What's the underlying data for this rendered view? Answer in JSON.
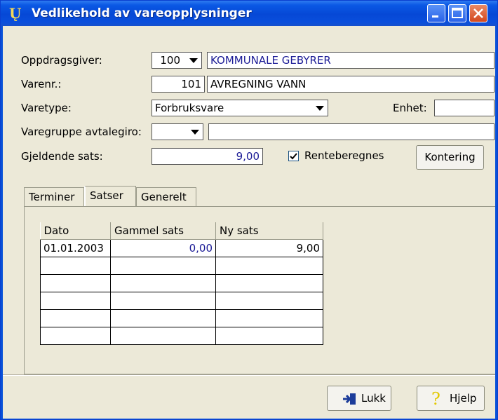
{
  "window": {
    "title": "Vedlikehold av vareopplysninger"
  },
  "form": {
    "oppdragsgiver_label": "Oppdragsgiver:",
    "oppdragsgiver_code": "100",
    "oppdragsgiver_name": "KOMMUNALE GEBYRER",
    "varenr_label": "Varenr.:",
    "varenr_code": "101",
    "varenr_name": "AVREGNING VANN",
    "varetype_label": "Varetype:",
    "varetype_value": "Forbruksvare",
    "enhet_label": "Enhet:",
    "enhet_value": "",
    "varegruppe_label": "Varegruppe avtalegiro:",
    "varegruppe_code": "",
    "varegruppe_name": "",
    "sats_label": "Gjeldende sats:",
    "sats_value": "9,00",
    "renteberegnes_label": "Renteberegnes",
    "renteberegnes_checked": true,
    "kontering_label": "Kontering"
  },
  "tabs": [
    {
      "label": "Terminer",
      "active": false
    },
    {
      "label": "Satser",
      "active": true
    },
    {
      "label": "Generelt",
      "active": false
    }
  ],
  "table": {
    "headers": [
      "Dato",
      "Gammel sats",
      "Ny sats"
    ],
    "rows": [
      [
        "01.01.2003",
        "0,00",
        "9,00"
      ],
      [
        "",
        "",
        ""
      ],
      [
        "",
        "",
        ""
      ],
      [
        "",
        "",
        ""
      ],
      [
        "",
        "",
        ""
      ],
      [
        "",
        "",
        ""
      ]
    ]
  },
  "buttons": {
    "lukk": "Lukk",
    "hjelp": "Hjelp"
  },
  "colors": {
    "titlebar": "#0a58e4",
    "window_bg": "#ece9d8",
    "value_text": "#1b1b96",
    "close_button": "#d3481d"
  }
}
